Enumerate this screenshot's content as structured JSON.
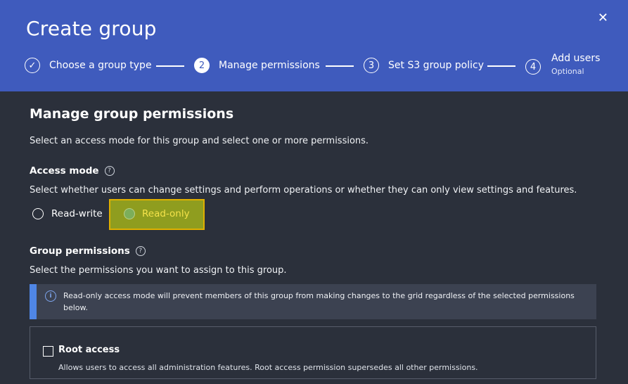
{
  "dialog": {
    "title": "Create group",
    "close_glyph": "✕"
  },
  "steps": [
    {
      "marker": "✓",
      "label": "Choose a group type",
      "state": "completed"
    },
    {
      "marker": "2",
      "label": "Manage permissions",
      "state": "active"
    },
    {
      "marker": "3",
      "label": "Set S3 group policy",
      "state": "pending"
    },
    {
      "marker": "4",
      "label": "Add users",
      "sublabel": "Optional",
      "state": "pending"
    }
  ],
  "main": {
    "heading": "Manage group permissions",
    "intro": "Select an access mode for this group and select one or more permissions."
  },
  "access_mode": {
    "title": "Access mode",
    "help_glyph": "?",
    "description": "Select whether users can change settings and perform operations or whether they can only view settings and features.",
    "options": [
      {
        "label": "Read-write",
        "selected": false
      },
      {
        "label": "Read-only",
        "selected": true
      }
    ]
  },
  "group_permissions": {
    "title": "Group permissions",
    "help_glyph": "?",
    "description": "Select the permissions you want to assign to this group.",
    "info_glyph": "i",
    "info": "Read-only access mode will prevent members of this group from making changes to the grid regardless of the selected permissions below.",
    "permissions": [
      {
        "name": "Root access",
        "checked": false,
        "description": "Allows users to access all administration features. Root access permission supersedes all other permissions."
      }
    ]
  },
  "colors": {
    "header": "#3f5bbd",
    "body": "#2b303b",
    "highlight": "#8f9d1f",
    "highlight_border": "#e0b000",
    "info_accent": "#4f86e6"
  }
}
